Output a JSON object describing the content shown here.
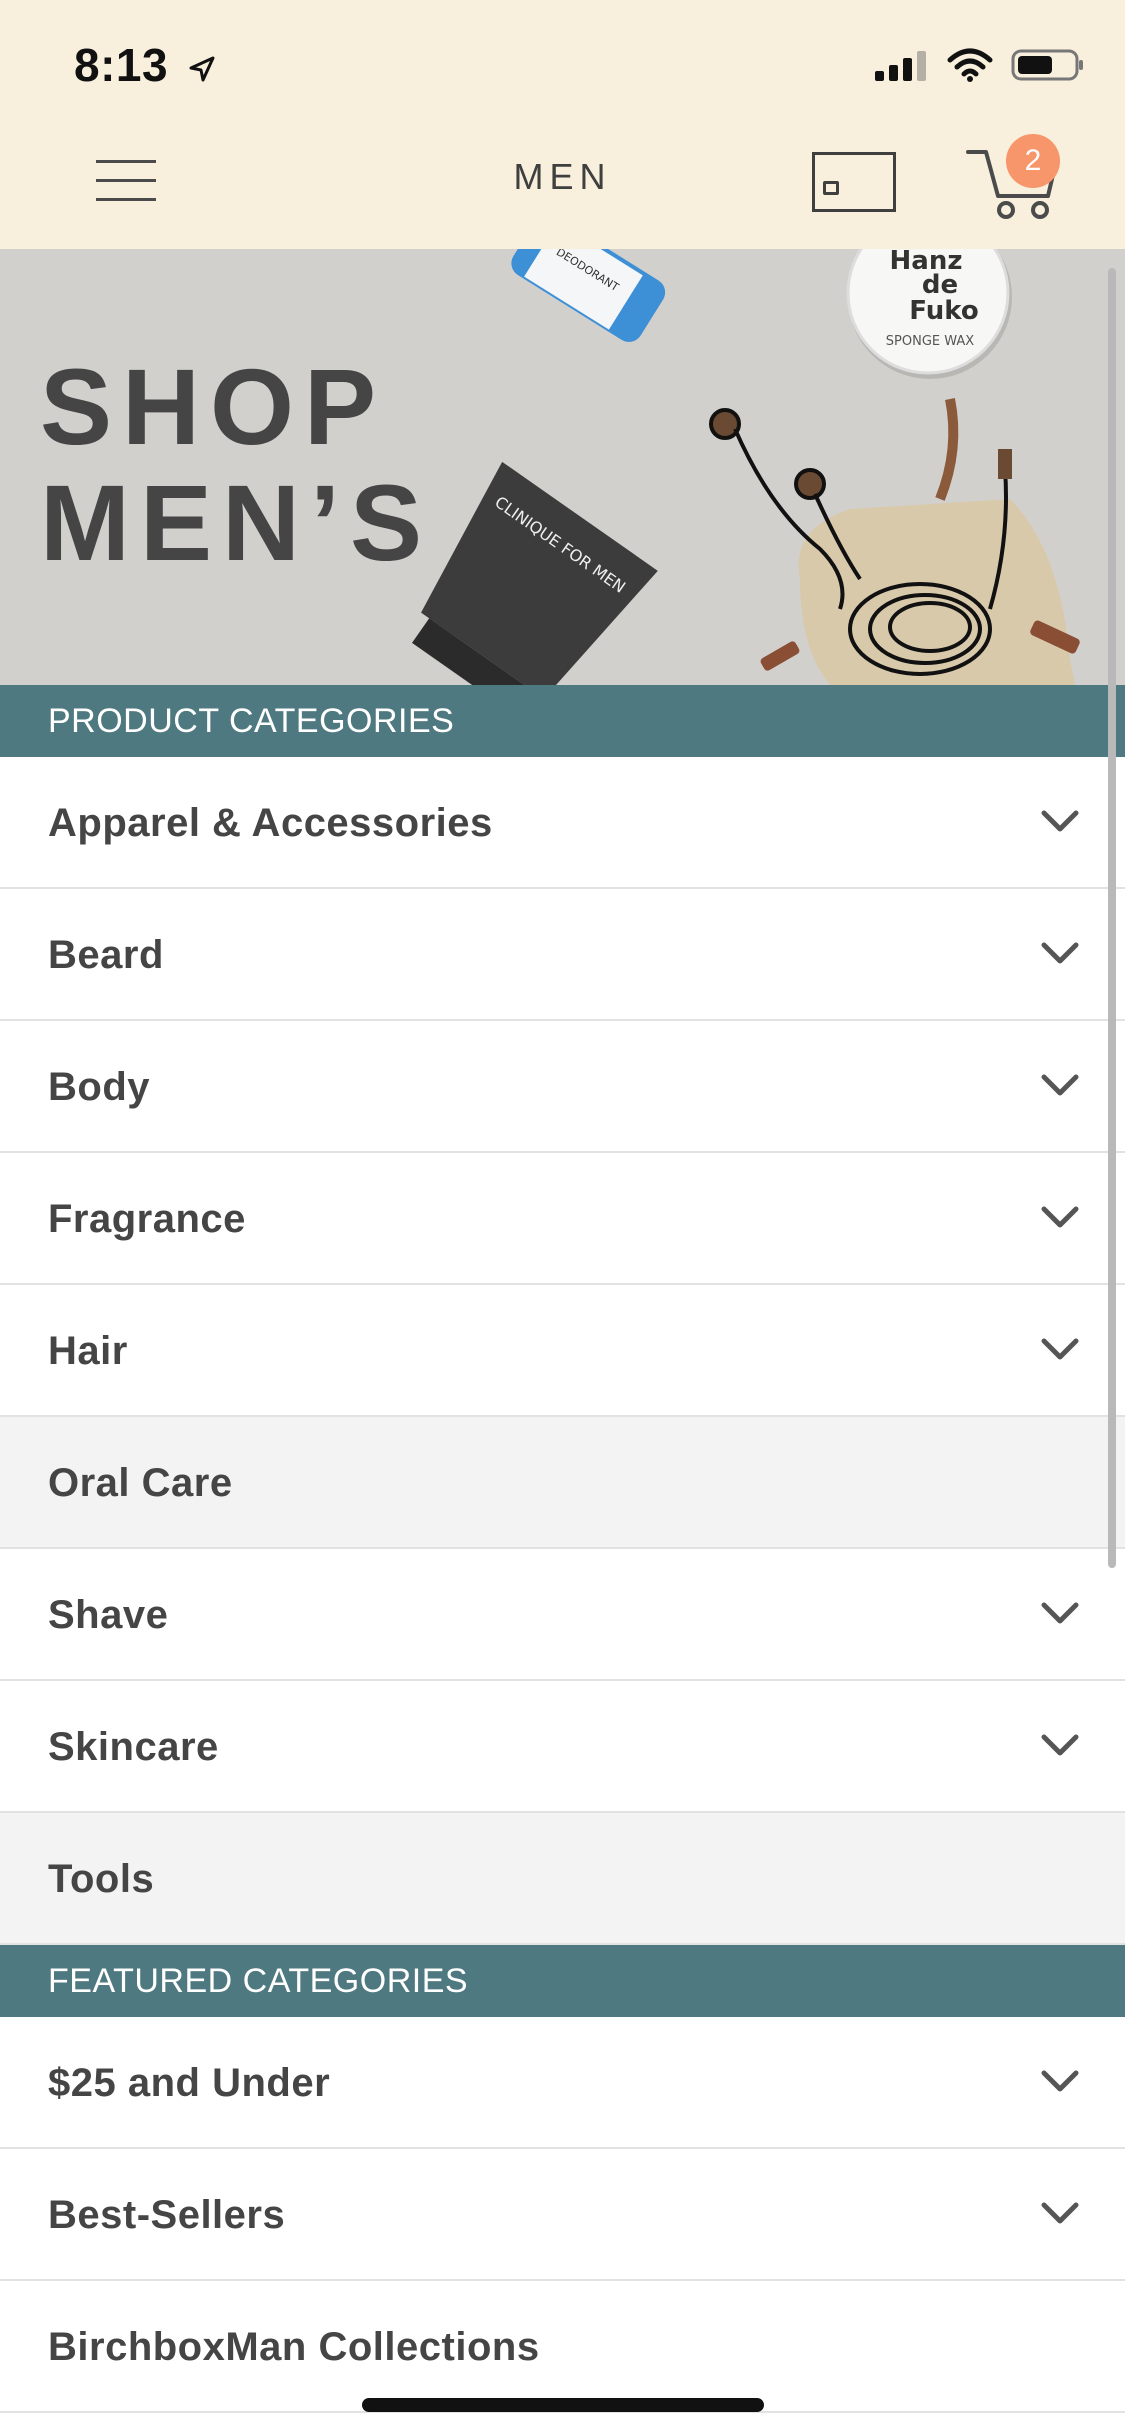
{
  "status_bar": {
    "time": "8:13"
  },
  "header": {
    "title": "MEN",
    "cart_count": "2"
  },
  "hero": {
    "title_line1": "SHOP",
    "title_line2": "MEN’S",
    "jar_brand_line1": "Hanz",
    "jar_brand_line2": "de",
    "jar_brand_line3": "Fuko",
    "jar_product": "SPONGE WAX",
    "stick_label": "DEODORANT",
    "tube_label": "CLINIQUE FOR MEN"
  },
  "product_categories": {
    "header": "PRODUCT CATEGORIES",
    "items": [
      {
        "label": "Apparel & Accessories",
        "expandable": true
      },
      {
        "label": "Beard",
        "expandable": true
      },
      {
        "label": "Body",
        "expandable": true
      },
      {
        "label": "Fragrance",
        "expandable": true
      },
      {
        "label": "Hair",
        "expandable": true
      },
      {
        "label": "Oral Care",
        "expandable": false
      },
      {
        "label": "Shave",
        "expandable": true
      },
      {
        "label": "Skincare",
        "expandable": true
      },
      {
        "label": "Tools",
        "expandable": false
      }
    ]
  },
  "featured_categories": {
    "header": "FEATURED CATEGORIES",
    "items": [
      {
        "label": "$25 and Under",
        "expandable": true
      },
      {
        "label": "Best-Sellers",
        "expandable": true
      },
      {
        "label": "BirchboxMan Collections",
        "expandable": false
      }
    ]
  },
  "colors": {
    "header_bg": "#f8efdc",
    "section_header_bg": "#4f7980",
    "badge": "#f7956b",
    "hero_bg": "#d2d0cd"
  },
  "icons": [
    "menu-icon",
    "gift-card-icon",
    "cart-icon",
    "chevron-down-icon",
    "location-arrow-icon",
    "signal-icon",
    "wifi-icon",
    "battery-icon"
  ]
}
